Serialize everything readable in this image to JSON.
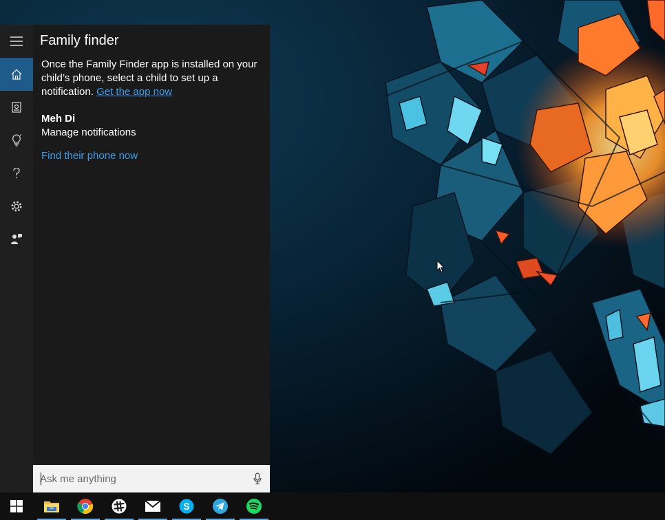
{
  "cortana": {
    "title": "Family finder",
    "intro_text": "Once the Family Finder app is installed on your child’s phone, select a child to set up a notification.",
    "get_app_link": "Get the app now",
    "child_name": "Meh Di",
    "manage_label": "Manage notifications",
    "find_phone_link": "Find their phone now",
    "search_placeholder": "Ask me anything",
    "accent_color": "#1e5b8b",
    "link_color": "#3d9de8",
    "rail_icons": [
      "hamburger-icon",
      "home-icon",
      "notebook-icon",
      "lightbulb-icon",
      "help-icon",
      "settings-icon",
      "feedback-icon"
    ]
  },
  "taskbar": {
    "icons": [
      "windows-start-icon",
      "file-explorer-icon",
      "chrome-icon",
      "slack-icon",
      "mail-icon",
      "skype-icon",
      "telegram-icon",
      "spotify-icon"
    ]
  }
}
